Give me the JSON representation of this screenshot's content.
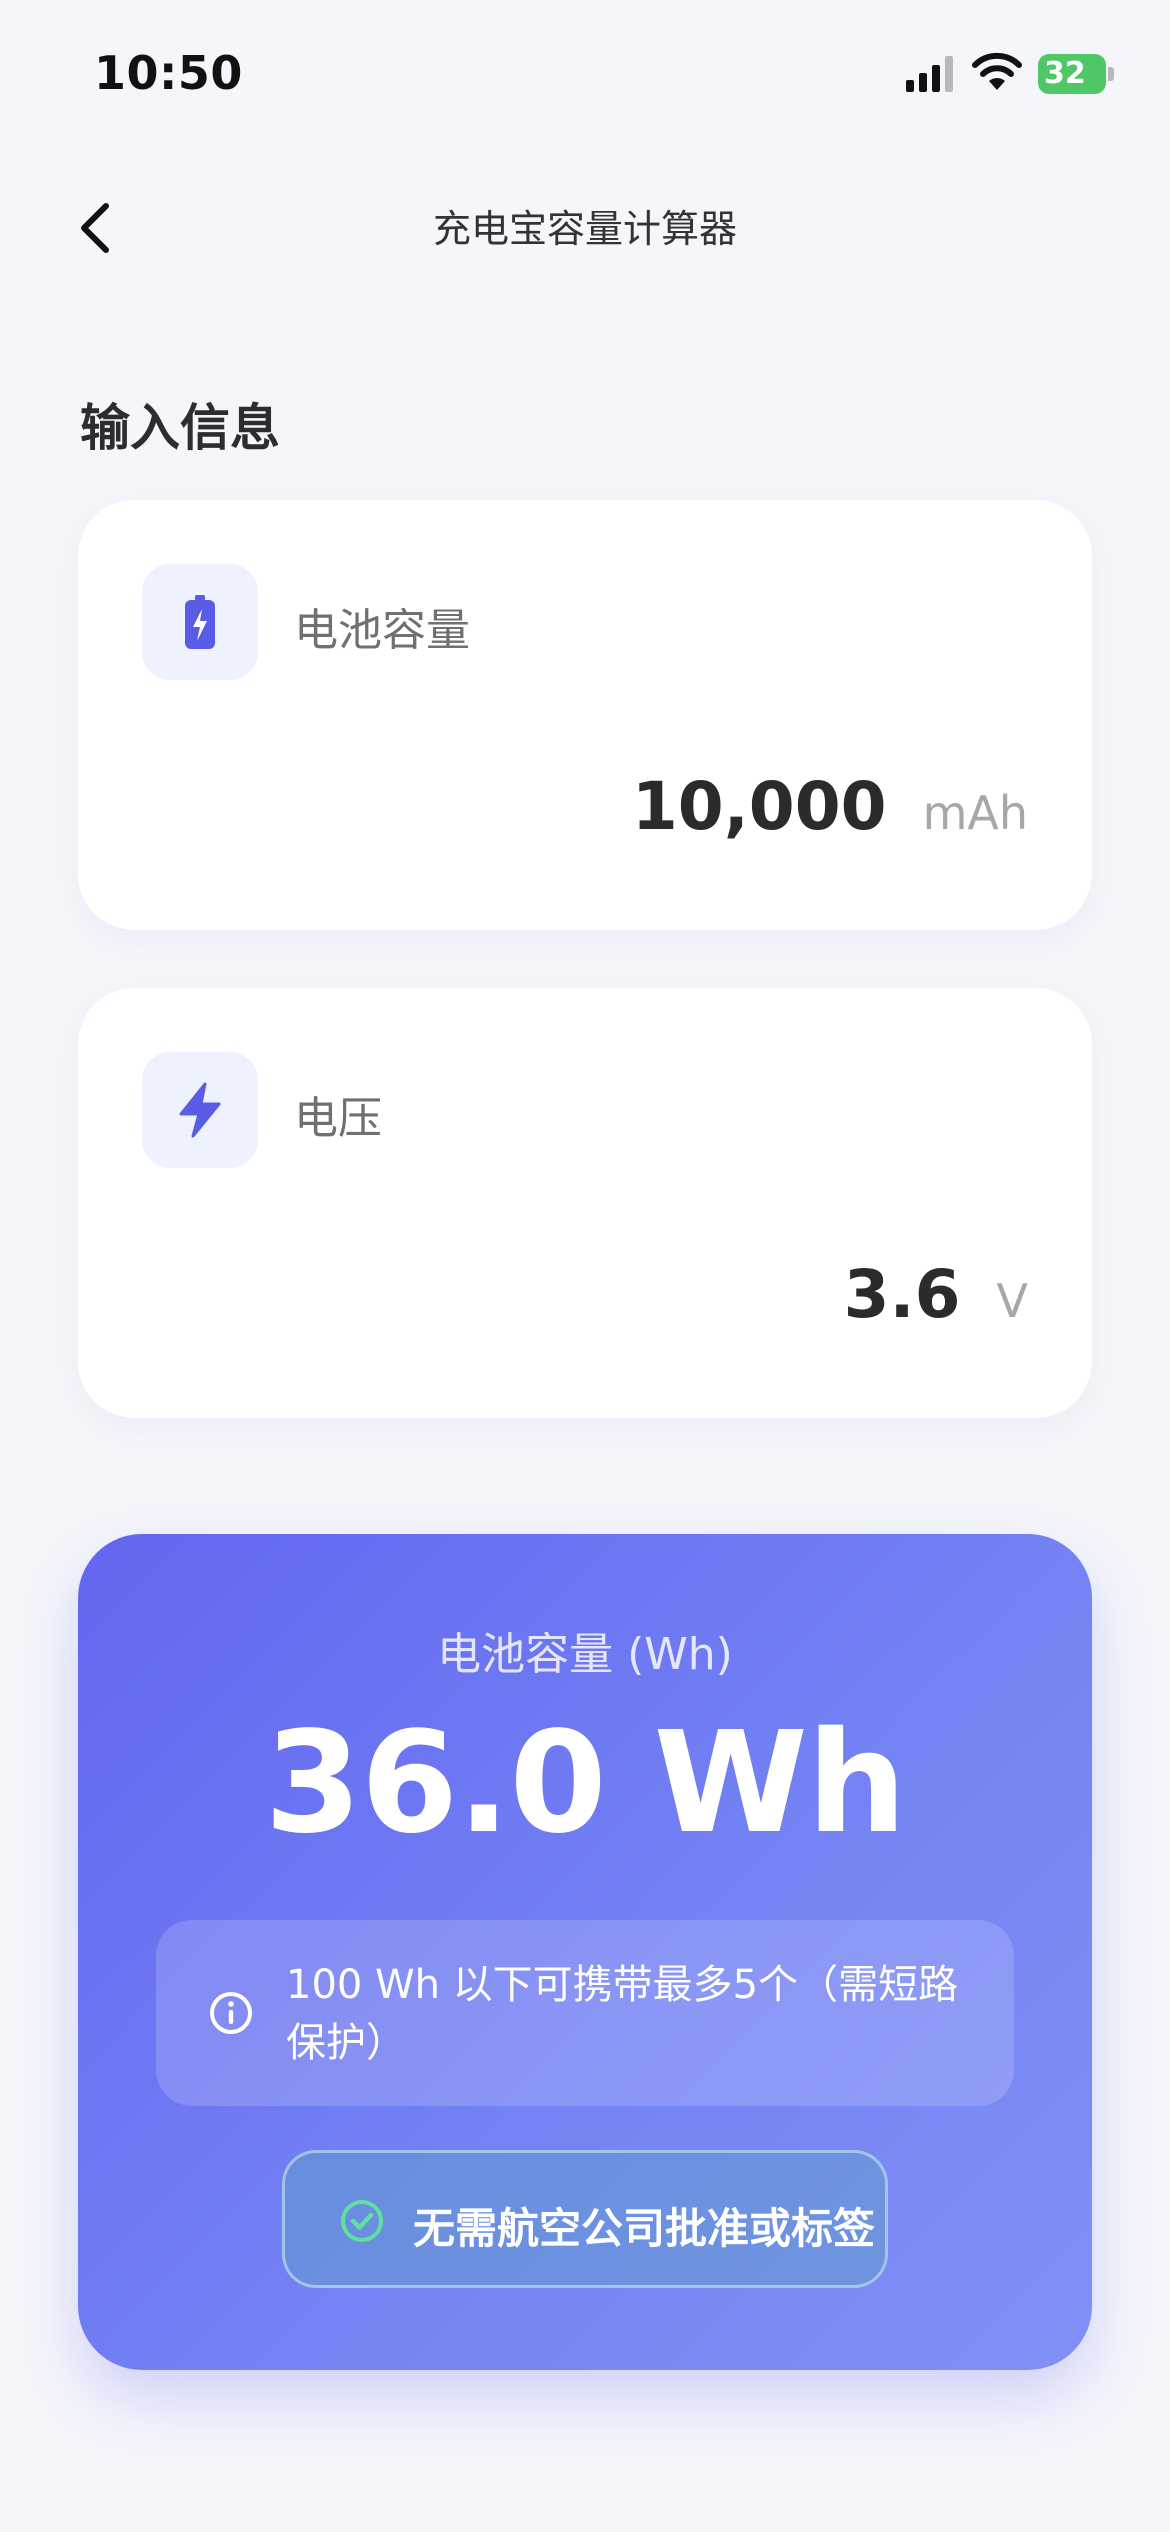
{
  "status_bar": {
    "time": "10:50",
    "battery_level": "32"
  },
  "nav": {
    "title": "充电宝容量计算器"
  },
  "section": {
    "title": "输入信息"
  },
  "inputs": [
    {
      "label": "电池容量",
      "value": "10,000",
      "unit": "mAh",
      "icon": "battery-icon"
    },
    {
      "label": "电压",
      "value": "3.6",
      "unit": "V",
      "icon": "lightning-icon"
    }
  ],
  "result": {
    "label": "电池容量 (Wh)",
    "value": "36.0 Wh",
    "info_text": "100 Wh 以下可携带最多5个（需短路保护）",
    "status_text": "无需航空公司批准或标签"
  },
  "colors": {
    "accent": "#6366f1",
    "success": "#4fc766",
    "background": "#f5f6fb"
  }
}
